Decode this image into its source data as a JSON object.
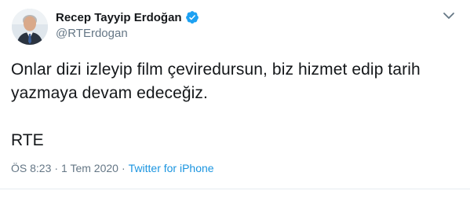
{
  "author": {
    "display_name": "Recep Tayyip Erdoğan",
    "handle": "@RTErdogan",
    "verified": true,
    "avatar_icon": "profile-photo"
  },
  "tweet": {
    "text_lines": [
      "Onlar dizi izleyip film çeviredursun, biz hizmet edip tarih",
      "yazmaya devam edeceğiz."
    ],
    "signature": "RTE"
  },
  "meta": {
    "time": "ÖS 8:23",
    "separator": "·",
    "date": "1 Tem 2020",
    "source": "Twitter for iPhone"
  },
  "colors": {
    "text": "#14171a",
    "secondary": "#657786",
    "link": "#1b95e0",
    "verified": "#1da1f2"
  },
  "icons": {
    "verified": "verified-badge-icon",
    "menu": "chevron-down-icon"
  }
}
